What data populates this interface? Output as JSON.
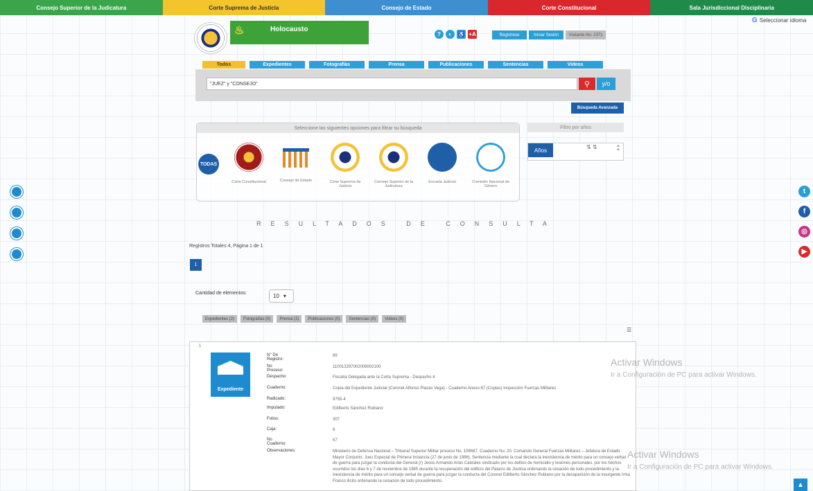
{
  "topnav": [
    {
      "label": "Consejo Superior de la Judicatura",
      "color": "#3aa54a"
    },
    {
      "label": "Corte Suprema de Justicia",
      "color": "#f3c42b",
      "text_color": "#333"
    },
    {
      "label": "Consejo de Estado",
      "color": "#3d8fd2"
    },
    {
      "label": "Corte Constitucional",
      "color": "#d9272e"
    },
    {
      "label": "Sala Jurisdiccional Disciplinaria",
      "color": "#1f8a4a"
    }
  ],
  "language": {
    "label": "Seleccionar idioma"
  },
  "header": {
    "site_title": "Holocausto",
    "register": "Registrese",
    "login": "Iniciar Sesión",
    "visitor": "Visitante No: 2371",
    "font_btn": "+A"
  },
  "tabs": [
    "Todos",
    "Expedientes",
    "Fotografías",
    "Prensa",
    "Publicaciones",
    "Sentencias",
    "Videos"
  ],
  "search": {
    "value": "\"JUEZ\" y \"CONSEJO\"",
    "yo_label": "y/o",
    "advanced": "Búsqueda Avanzada"
  },
  "filters": {
    "heading": "Seleccione las siguientes opciones para filtrar su búsqueda",
    "todas": "TODAS",
    "corporations": [
      {
        "label": "Corte Constitucional"
      },
      {
        "label": "Consejo de Estado"
      },
      {
        "label": "Corte Suprema de Justicia"
      },
      {
        "label": "Consejo Superior de la Judicatura"
      },
      {
        "label": "Escuela Judicial"
      },
      {
        "label": "Comisión Nacional de Género"
      }
    ]
  },
  "years": {
    "heading": "Filtro por años",
    "button": "Años"
  },
  "results": {
    "title": "RESULTADOS DE CONSULTA",
    "total": "Registros Totales 4, Página 1 de 1",
    "page": "1",
    "quantity_label": "Cantidad de elementos:",
    "quantity_value": "10",
    "chips": [
      "Expedientes (2)",
      "Fotografías (0)",
      "Prensa (2)",
      "Publicaciones (0)",
      "Sentencias (0)",
      "Videos (0)"
    ]
  },
  "record": {
    "index": "1",
    "type_label": "Expediente",
    "fields": [
      {
        "k": "N° De Registro:",
        "v": "89"
      },
      {
        "k": "No Proceso:",
        "v": "110013297002008002100"
      },
      {
        "k": "Despacho:",
        "v": "Fiscalía Delegada ante la Corte Suprema - Despacho 4"
      },
      {
        "k": "Cuaderno:",
        "v": "Copia del Expediente Judicial (Coronel Alfonso Plazas Vega) - Cuaderno Anexo 67 (Copias) Inspección Fuerzas Militares"
      },
      {
        "k": "Radicado:",
        "v": "9755-4"
      },
      {
        "k": "Imputado:",
        "v": "Edilberto Sánchez Rubiano"
      },
      {
        "k": "Folios:",
        "v": "307"
      },
      {
        "k": "Caja:",
        "v": "6"
      },
      {
        "k": "No Cuaderno:",
        "v": "67"
      },
      {
        "k": "Observaciones:",
        "v": "Ministerio de Defensa Nacional – Tribunal Superior Militar proceso No. 109687. Cuaderno No. 20. Comando General Fuerzas Militares – Jefatura de Estado Mayor Conjunto. Juez Especial de Primera Instancia (27 de junio de 1986). Sentencia mediante la cual declara la inexistencia de mérito para un consejo verbal de guerra para juzgar la conducta del General (r) Jesús Armando Arias Cabrales sindicado por los delitos de homicidio y lesiones personales, por los hechos ocurridos los días 6 y 7 de noviembre de 1985 durante la recuperación del edificio del Palacio de Justicia ordenando la cesación de todo procedimiento y la inexistencia de mérito para un consejo verbal de guerra para juzgar la conducta del Coronel Edilberto Sánchez Rubiano por la desaparición de la insurgente Irma Franco ilícito ordenando la cesación de todo procedimiento."
      }
    ]
  },
  "watermark": {
    "line1": "Activar Windows",
    "line2": "Ir a Configuración de PC para activar Windows."
  }
}
